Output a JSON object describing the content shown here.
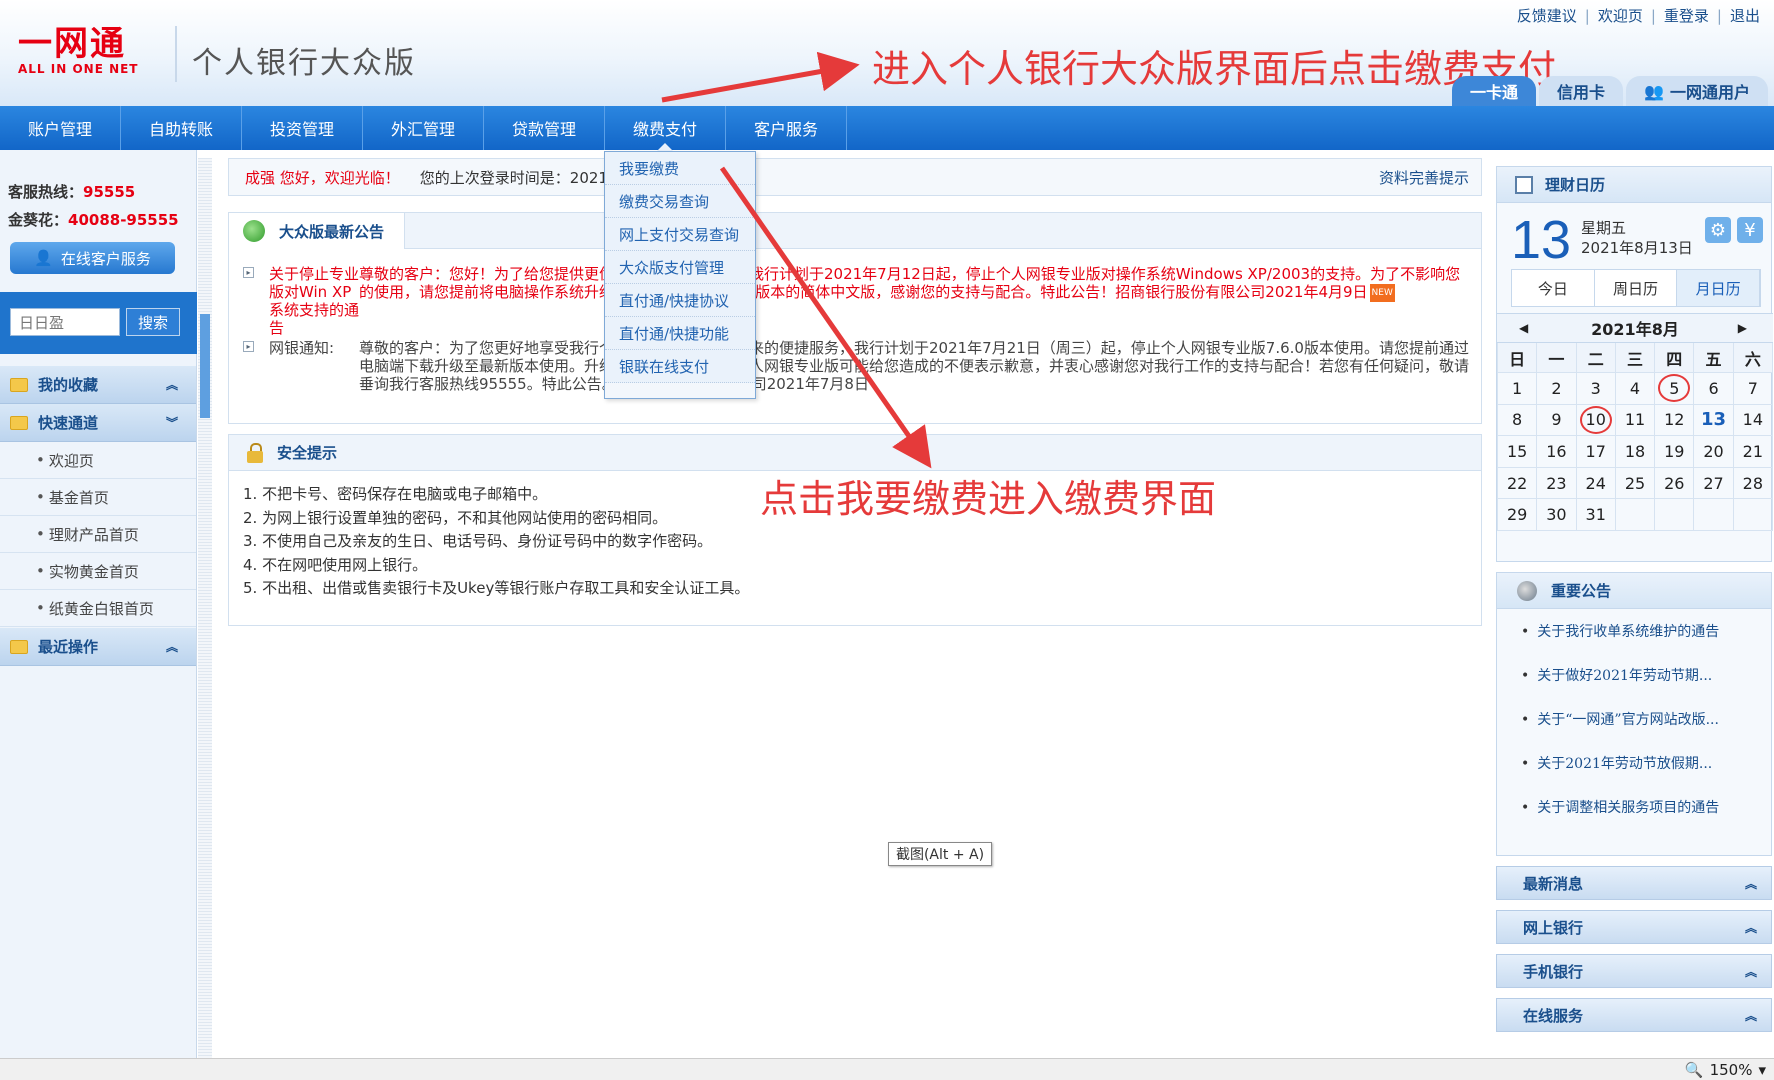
{
  "header": {
    "logo_text": "一网通",
    "logo_sub": "ALL IN ONE NET",
    "app_title": "个人银行大众版",
    "top_links": [
      "反馈建议",
      "欢迎页",
      "重登录",
      "退出"
    ],
    "user_tabs": [
      "一卡通",
      "信用卡",
      "一网通用户"
    ]
  },
  "annotations": {
    "top": "进入个人银行大众版界面后点击缴费支付",
    "middle": "点击我要缴费进入缴费界面"
  },
  "nav": {
    "items": [
      "账户管理",
      "自助转账",
      "投资管理",
      "外汇管理",
      "贷款管理",
      "缴费支付",
      "客户服务"
    ],
    "active_index": 5
  },
  "dropdown": {
    "items": [
      "我要缴费",
      "缴费交易查询",
      "网上支付交易查询",
      "大众版支付管理",
      "直付通/快捷协议",
      "直付通/快捷功能",
      "银联在线支付"
    ]
  },
  "left": {
    "hotline_label": "客服热线：",
    "hotline_number": "95555",
    "jinkuihua_label": "金葵花：",
    "jinkuihua_number": "40088-95555",
    "online_service": "在线客户服务",
    "search_value": "日日盈",
    "search_button": "搜索",
    "favorites": "我的收藏",
    "quick_channel": "快速通道",
    "quick_items": [
      "欢迎页",
      "基金首页",
      "理财产品首页",
      "实物黄金首页",
      "纸黄金白银首页"
    ],
    "recent": "最近操作"
  },
  "welcome": {
    "name": "成强 您好，欢迎光临！",
    "last_login": "您的上次登录时间是：2021",
    "profile_hint": "资料完善提示"
  },
  "notice": {
    "tab": "大众版最新公告",
    "row1_label": "关于停止专业版对Win XP系统支持的通告",
    "row1_text": "尊敬的客户：您好！为了给您提供更优质、更安全的服务，我行计划于2021年7月12日起，停止个人网银专业版对操作系统Windows XP/2003的支持。为了不影响您的使用，请您提前将电脑操作系统升级为Windows 7或更高版本的简体中文版，感谢您的支持与配合。特此公告！招商银行股份有限公司2021年4月9日",
    "row2_label": "网银通知:",
    "row2_text": "尊敬的客户：为了您更好地享受我行个人网银专业版为您带来的便捷服务，我行计划于2021年7月21日（周三）起，停止个人网银专业版7.6.0版本使用。请您提前通过电脑端下载升级至最新版本使用。升级期间部分用户使用个人网银专业版可能给您造成的不便表示歉意，并衷心感谢您对我行工作的支持与配合！若您有任何疑问，敬请垂询我行客服热线95555。特此公告。招商银行股份有限公司2021年7月8日",
    "new_badge": "NEW"
  },
  "safety": {
    "title": "安全提示",
    "items": [
      "1. 不把卡号、密码保存在电脑或电子邮箱中。",
      "2. 为网上银行设置单独的密码，不和其他网站使用的密码相同。",
      "3. 不使用自己及亲友的生日、电话号码、身份证号码中的数字作密码。",
      "4. 不在网吧使用网上银行。",
      "5. 不出租、出借或售卖银行卡及Ukey等银行账户存取工具和安全认证工具。"
    ]
  },
  "screenshot_tip": "截图(Alt + A)",
  "calendar": {
    "title": "理财日历",
    "day": "13",
    "weekday": "星期五",
    "full_date": "2021年8月13日",
    "btn_gear": "⚙",
    "btn_yen": "¥",
    "view_tabs": [
      "今日",
      "周日历",
      "月日历"
    ],
    "active_view": 2,
    "month_label": "2021年8月",
    "weekday_headers": [
      "日",
      "一",
      "二",
      "三",
      "四",
      "五",
      "六"
    ],
    "days": [
      "1",
      "2",
      "3",
      "4",
      "5",
      "6",
      "7",
      "8",
      "9",
      "10",
      "11",
      "12",
      "13",
      "14",
      "15",
      "16",
      "17",
      "18",
      "19",
      "20",
      "21",
      "22",
      "23",
      "24",
      "25",
      "26",
      "27",
      "28",
      "29",
      "30",
      "31",
      "",
      "",
      "",
      ""
    ],
    "today": "13",
    "circled": [
      "5",
      "10"
    ]
  },
  "important": {
    "title": "重要公告",
    "items": [
      "关于我行收单系统维护的通告",
      "关于做好2021年劳动节期...",
      "关于“一网通”官方网站改版...",
      "关于2021年劳动节放假期...",
      "关于调整相关服务项目的通告"
    ]
  },
  "side_sections": [
    "最新消息",
    "网上银行",
    "手机银行",
    "在线服务"
  ],
  "status": {
    "zoom": "150%"
  }
}
